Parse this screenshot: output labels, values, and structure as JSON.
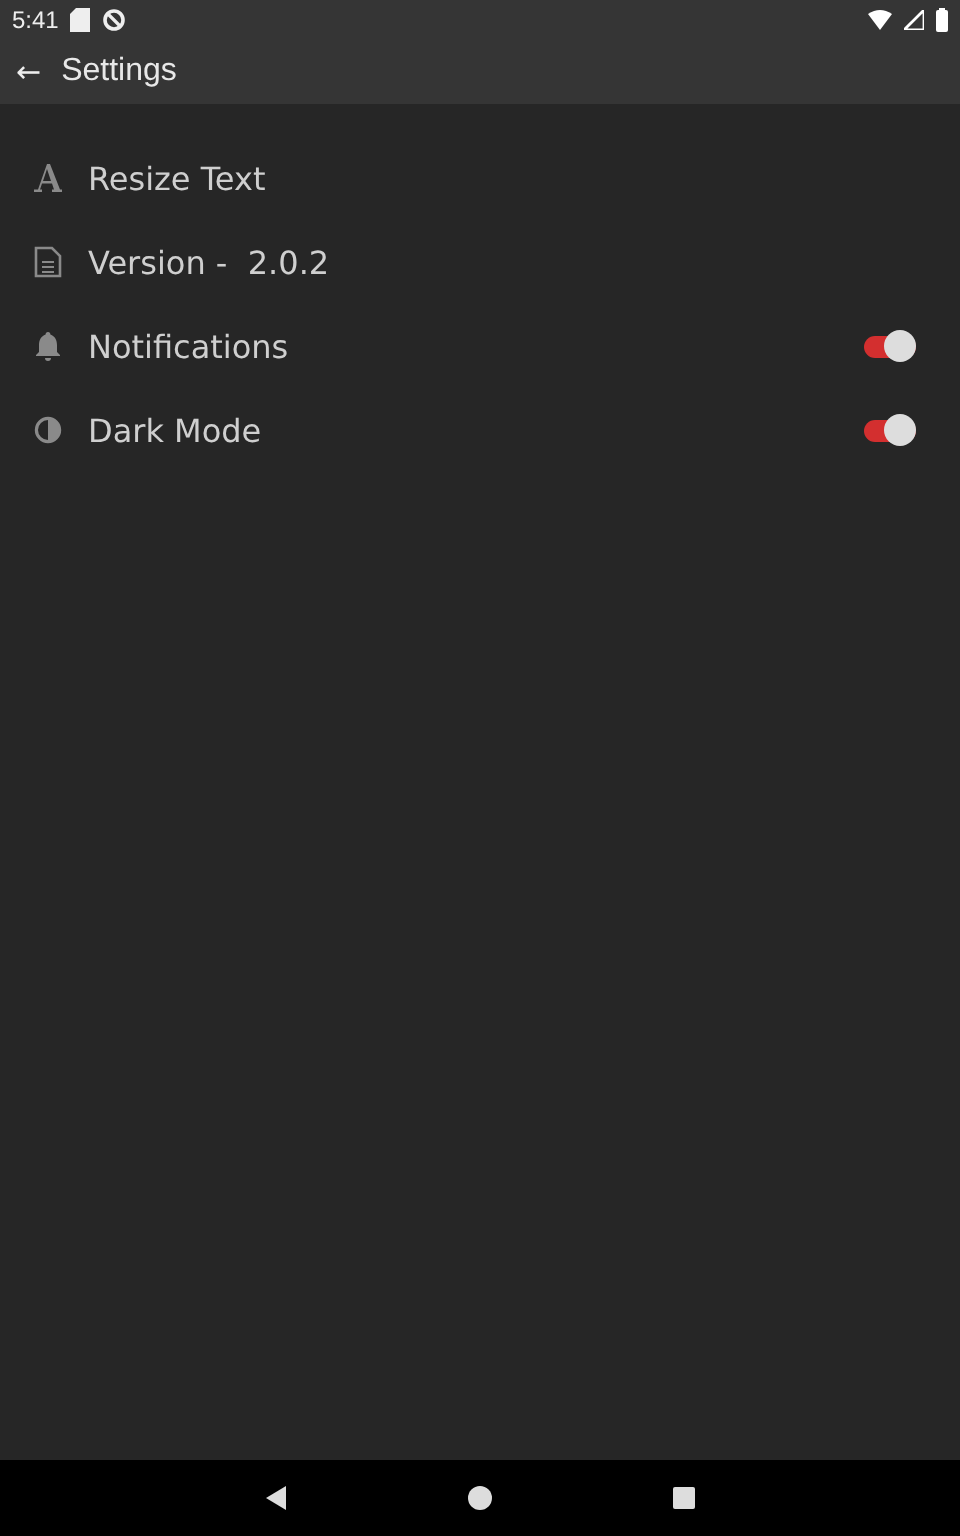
{
  "status_bar": {
    "time": "5:41"
  },
  "app_bar": {
    "back": "←",
    "title": "Settings"
  },
  "items": [
    {
      "kind": "action",
      "label": "Resize Text"
    },
    {
      "kind": "info",
      "label": "Version -  2.0.2"
    },
    {
      "kind": "toggle",
      "label": "Notifications",
      "on": true
    },
    {
      "kind": "toggle",
      "label": "Dark Mode",
      "on": true
    }
  ]
}
